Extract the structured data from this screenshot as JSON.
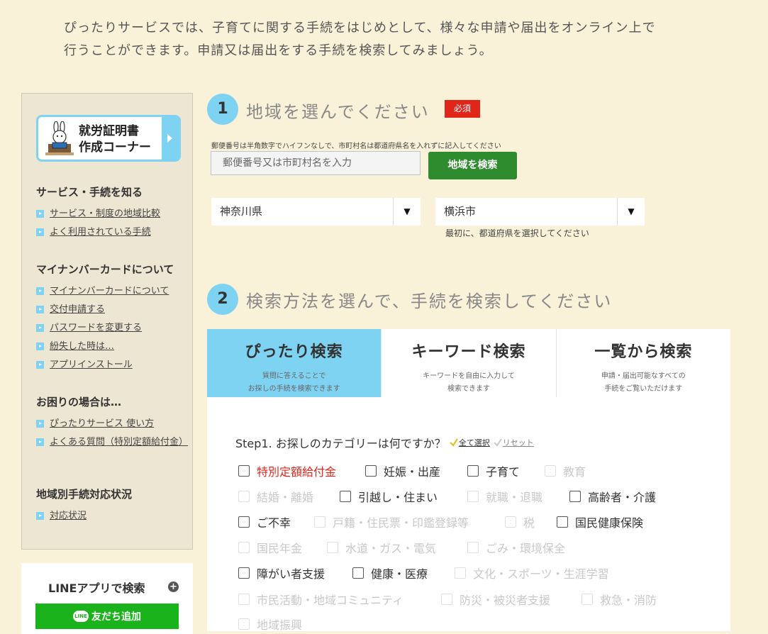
{
  "intro": {
    "line1": "ぴったりサービスでは、子育てに関する手続をはじめとして、様々な申請や届出をオンライン上で",
    "line2": "行うことができます。申請又は届出をする手続を検索してみましょう。"
  },
  "sidebar": {
    "banner": {
      "line1": "就労証明書",
      "line2": "作成コーナー"
    },
    "sections": [
      {
        "heading": "サービス・手続を知る",
        "links": [
          "サービス・制度の地域比較",
          "よく利用されている手続"
        ]
      },
      {
        "heading": "マイナンバーカードについて",
        "links": [
          "マイナンバーカードについて",
          "交付申請する",
          "パスワードを変更する",
          "紛失した時は…",
          "アプリインストール"
        ]
      },
      {
        "heading": "お困りの場合は…",
        "links": [
          "ぴったりサービス 使い方",
          "よくある質問（特別定額給付金）"
        ]
      },
      {
        "heading": "地域別手続対応状況",
        "links": [
          "対応状況"
        ]
      }
    ],
    "line": {
      "title": "LINEアプリで検索",
      "button": "友だち追加",
      "icon_text": "LINE"
    }
  },
  "step1": {
    "number": "1",
    "title": "地域を選んでください",
    "required": "必須",
    "hint": "郵便番号は半角数字でハイフンなしで、市町村名は都道府県名を入れずに記入してください",
    "placeholder": "郵便番号又は市町村名を入力",
    "search_button": "地域を検索",
    "prefecture": "神奈川県",
    "city": "横浜市",
    "city_note": "最初に、都道府県を選択してください"
  },
  "step2": {
    "number": "2",
    "title": "検索方法を選んで、手続を検索してください",
    "tabs": [
      {
        "title": "ぴったり検索",
        "sub1": "質問に答えることで",
        "sub2": "お探しの手続を検索できます"
      },
      {
        "title": "キーワード検索",
        "sub1": "キーワードを自由に入力して",
        "sub2": "検索できます"
      },
      {
        "title": "一覧から検索",
        "sub1": "申請・届出可能なすべての",
        "sub2": "手続をご覧いただけます"
      }
    ],
    "step_label": "Step1. お探しのカテゴリーは何ですか？",
    "select_all": "全て選択",
    "reset": "リセット",
    "categories": [
      "特別定額給付金",
      "妊娠・出産",
      "子育て",
      "教育",
      "結婚・離婚",
      "引越し・住まい",
      "就職・退職",
      "高齢者・介護",
      "ご不幸",
      "戸籍・住民票・印鑑登録等",
      "税",
      "国民健康保険",
      "国民年金",
      "水道・ガス・電気",
      "ごみ・環境保全",
      "障がい者支援",
      "健康・医療",
      "文化・スポーツ・生涯学習",
      "市民活動・地域コミュニティ",
      "防災・被災者支援",
      "救急・消防",
      "地域振興"
    ]
  },
  "colors": {
    "background": "#faf1d9",
    "accent": "#7fd3f2",
    "required": "#e0261b",
    "button_green": "#2e8b2e",
    "line_green": "#1bb31b"
  }
}
